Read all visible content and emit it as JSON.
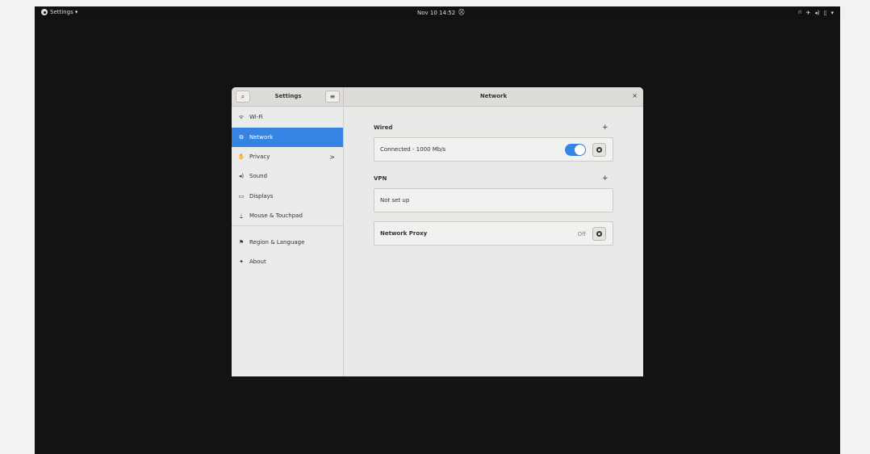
{
  "topbar": {
    "app_menu": "Settings ▾",
    "clock": "Nov 10  14:52",
    "tray_icons": [
      "network-icon",
      "airplane-icon",
      "volume-icon",
      "battery-icon",
      "dropdown-icon"
    ],
    "tray_glyphs": [
      "⛙",
      "✈",
      "◂)",
      "▯",
      "▾"
    ]
  },
  "header": {
    "left_title": "Settings",
    "right_title": "Network",
    "close": "×",
    "search_glyph": "⌕",
    "menu_glyph": "≡"
  },
  "sidebar": {
    "items": [
      {
        "label": "Wi-Fi",
        "icon": "wifi-icon",
        "glyph": "ᯤ"
      },
      {
        "label": "Network",
        "icon": "network-icon",
        "glyph": "⧉"
      },
      {
        "label": "Privacy",
        "icon": "hand-icon",
        "glyph": "✋",
        "arrow": ">"
      },
      {
        "label": "Sound",
        "icon": "speaker-icon",
        "glyph": "◂)"
      },
      {
        "label": "Displays",
        "icon": "display-icon",
        "glyph": "▭"
      },
      {
        "label": "Mouse & Touchpad",
        "icon": "mouse-icon",
        "glyph": "⍊"
      },
      {
        "label": "Region & Language",
        "icon": "flag-icon",
        "glyph": "⚑"
      },
      {
        "label": "About",
        "icon": "star-icon",
        "glyph": "✦"
      }
    ],
    "active_index": 1
  },
  "content": {
    "wired": {
      "title": "Wired",
      "plus": "+",
      "connection": "Connected - 1000 Mb/s",
      "switch_on": true
    },
    "vpn": {
      "title": "VPN",
      "plus": "+",
      "status": "Not set up"
    },
    "proxy": {
      "label": "Network Proxy",
      "status": "Off"
    }
  },
  "colors": {
    "accent": "#3584e4",
    "desktop": "#131313",
    "window_bg": "#e8e8e7"
  }
}
